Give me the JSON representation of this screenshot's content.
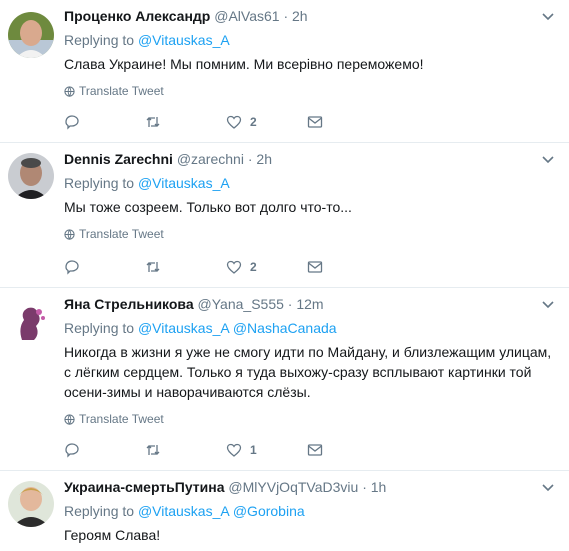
{
  "tweets": [
    {
      "name": "Проценко Александр",
      "handle": "@AlVas61",
      "dot": "·",
      "time": "2h",
      "replying_prefix": "Replying to",
      "replying_to": [
        "@Vitauskas_A"
      ],
      "text": "Слава Украине! Мы помним. Ми всерівно переможемо!",
      "translate": "Translate Tweet",
      "likes": "2"
    },
    {
      "name": "Dennis Zarechni",
      "handle": "@zarechni",
      "dot": "·",
      "time": "2h",
      "replying_prefix": "Replying to",
      "replying_to": [
        "@Vitauskas_A"
      ],
      "text": "Мы тоже созреем. Только вот долго что-то...",
      "translate": "Translate Tweet",
      "likes": "2"
    },
    {
      "name": "Яна Стрельникова",
      "handle": "@Yana_S555",
      "dot": "·",
      "time": "12m",
      "replying_prefix": "Replying to",
      "replying_to": [
        "@Vitauskas_A",
        "@NashaCanada"
      ],
      "text": "Никогда в жизни я уже не смогу идти по Майдану, и близлежащим улицам, с лёгким сердцем. Только я туда выхожу-сразу всплывают картинки той осени-зимы и наворачиваются слёзы.",
      "translate": "Translate Tweet",
      "likes": "1"
    },
    {
      "name": "Украина-смертьПутина",
      "handle": "@MlYVjOqTVaD3viu",
      "dot": "·",
      "time": "1h",
      "replying_prefix": "Replying to",
      "replying_to": [
        "@Vitauskas_A",
        "@Gorobina"
      ],
      "text": "Героям Слава!"
    }
  ],
  "colors": {
    "accent": "#1da1f2",
    "muted": "#657786",
    "text": "#14171a",
    "divider": "#e6ecf0"
  },
  "icons": [
    "globe-icon",
    "reply-icon",
    "retweet-icon",
    "like-icon",
    "direct-message-icon",
    "chevron-down-icon"
  ]
}
